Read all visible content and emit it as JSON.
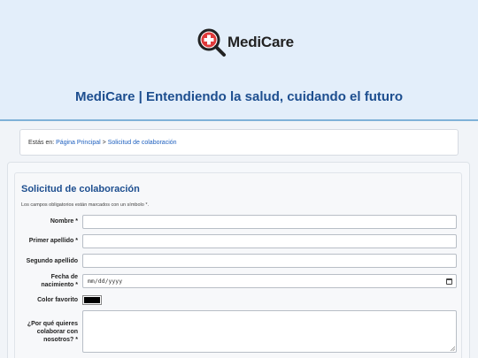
{
  "header": {
    "logo_text": "MediCare",
    "tagline": "MediCare | Entendiendo la salud, cuidando el futuro"
  },
  "breadcrumb": {
    "prefix": "Estás en: ",
    "home": "Página Principal",
    "separator": " > ",
    "current": "Solicitud de colaboración"
  },
  "form": {
    "title": "Solicitud de colaboración",
    "note": "Los campos obligatorios están marcados con un símbolo *.",
    "fields": [
      {
        "label": "Nombre *",
        "value": ""
      },
      {
        "label": "Primer apellido *",
        "value": ""
      },
      {
        "label": "Segundo apellido",
        "value": ""
      },
      {
        "label": "Fecha de nacimiento *",
        "placeholder": "mm/dd/yyyy"
      },
      {
        "label": "Color favorito",
        "value": "#000000"
      },
      {
        "label": "¿Por qué quieres colaborar con nosotros? *",
        "value": ""
      }
    ]
  },
  "colors": {
    "brand_blue": "#1d4e8f",
    "header_bg": "#e3eefa",
    "logo_red": "#e03a3a",
    "link": "#1d5fbf"
  },
  "icons": [
    "magnifier-cross-logo-icon",
    "calendar-icon",
    "resize-handle-icon"
  ]
}
